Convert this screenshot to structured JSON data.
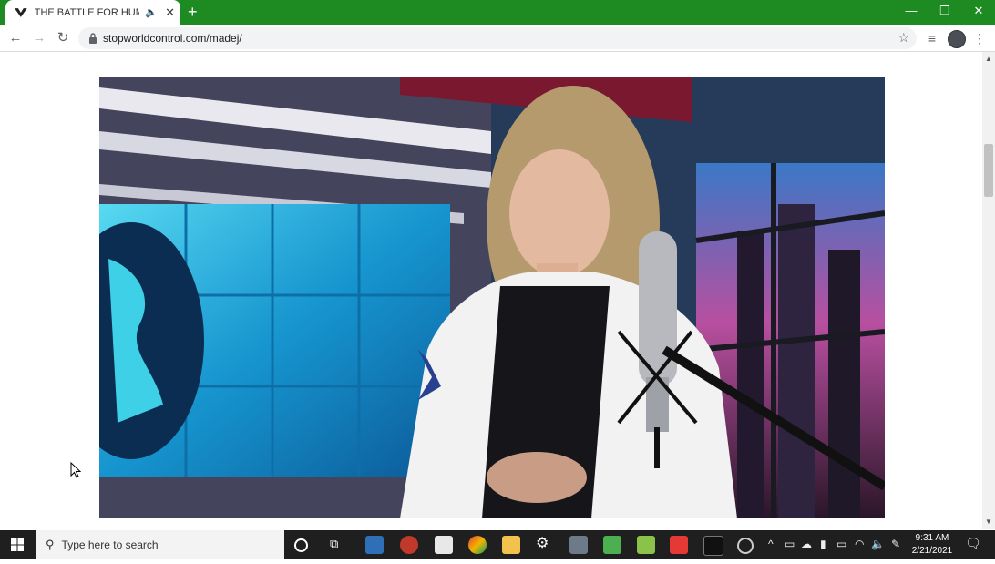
{
  "browser": {
    "tab_title": "THE BATTLE FOR HUMANITY",
    "url": "stopworldcontrol.com/madej/"
  },
  "taskbar": {
    "search_placeholder": "Type here to search",
    "time": "9:31 AM",
    "date": "2/21/2021"
  },
  "icons": {
    "favicon": "stopworldcontrol-logo",
    "tab_audio": "speaker-icon",
    "back": "arrow-left-icon",
    "forward": "arrow-right-icon",
    "reload": "reload-icon",
    "lock": "lock-icon",
    "bookmark": "star-icon",
    "media": "media-control-icon",
    "profile": "avatar",
    "menu": "kebab-menu-icon"
  },
  "colors": {
    "tabstrip": "#1d8a22",
    "taskbar": "#1f1f1f"
  }
}
